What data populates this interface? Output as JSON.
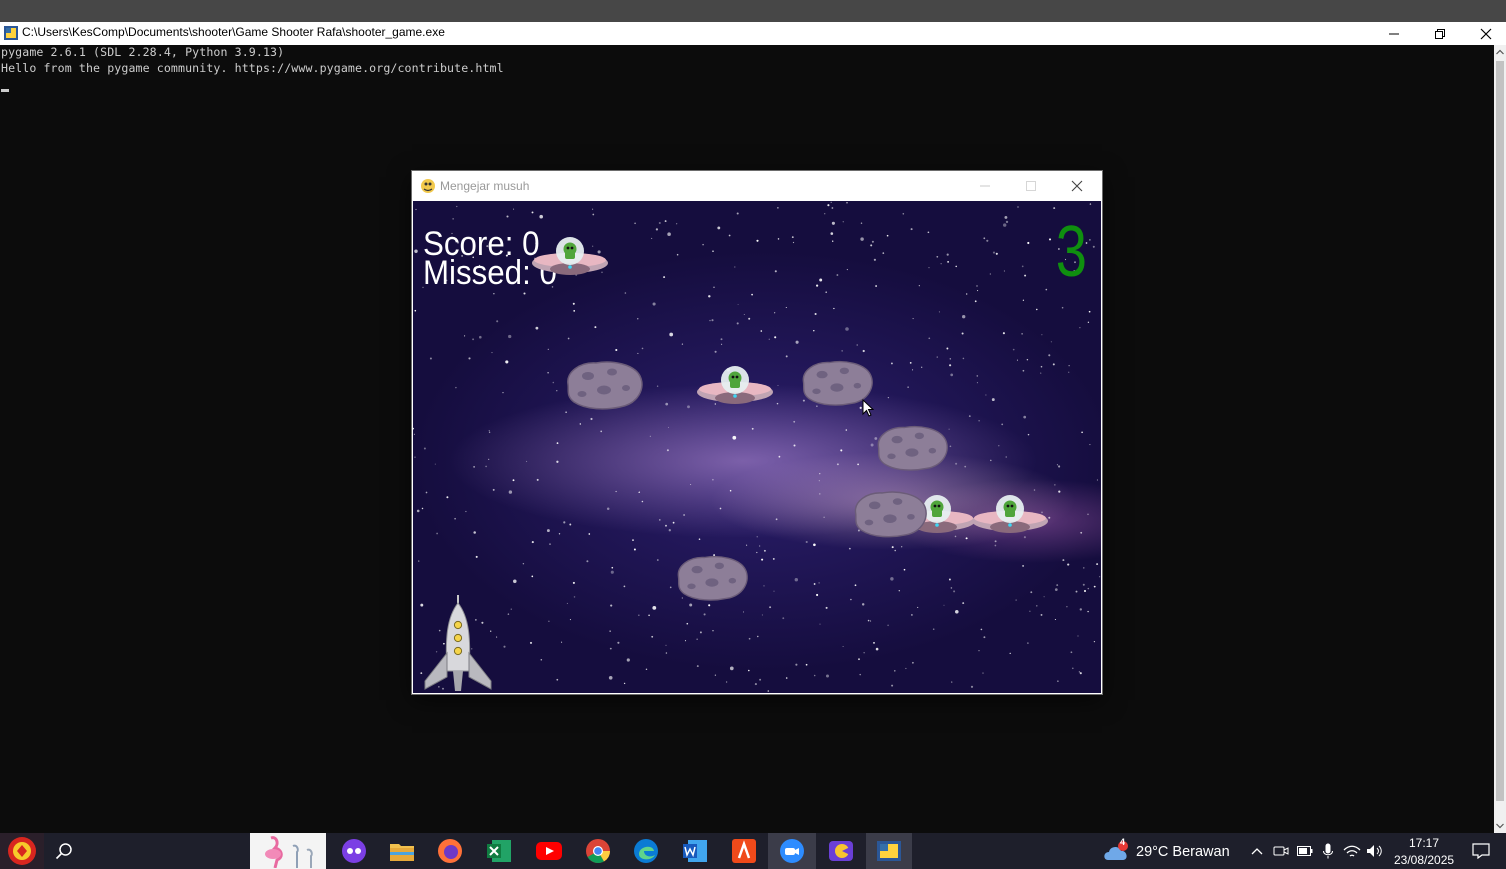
{
  "console_window": {
    "title": "C:\\Users\\KesComp\\Documents\\shooter\\Game Shooter Rafa\\shooter_game.exe",
    "lines": [
      "pygame 2.6.1 (SDL 2.28.4, Python 3.9.13)",
      "Hello from the pygame community. https://www.pygame.org/contribute.html"
    ]
  },
  "game_window": {
    "title": "Mengejar musuh",
    "score_label": "Score: 0",
    "missed_label": "Missed: 0",
    "lives": "3"
  },
  "sprites": {
    "ufo": "ufo-enemy",
    "asteroid": "asteroid",
    "rocket": "player-rocket"
  },
  "taskbar": {
    "apps": [
      "start-icon",
      "search-icon",
      "app-icon",
      "game-app-icon",
      "file-explorer-icon",
      "firefox-icon",
      "excel-icon",
      "youtube-icon",
      "chrome-icon",
      "edge-icon",
      "word-icon",
      "app-icon",
      "zoom-icon",
      "app-icon",
      "pygame-icon"
    ],
    "weather_badge": "4",
    "weather": "29°C  Berawan",
    "time": "17:17",
    "date": "23/08/2025"
  },
  "colors": {
    "lives_green": "#0f8f0f",
    "taskbar": "#1e1f2b",
    "console_bg": "#0c0c0c"
  }
}
